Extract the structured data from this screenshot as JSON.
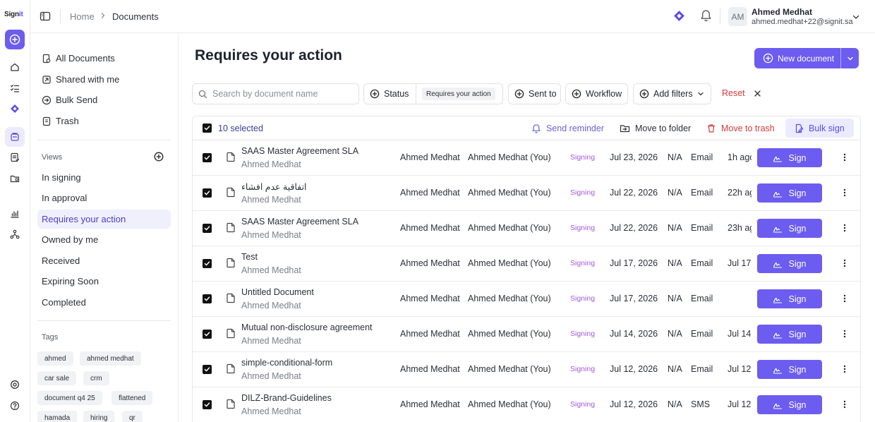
{
  "app": {
    "logo_main": "Sign",
    "logo_accent": "it"
  },
  "colors": {
    "accent": "#6d5cf0",
    "danger": "#d33a3a",
    "status_signing": "#a35bd6"
  },
  "rail": {
    "icons": [
      "new-document-icon",
      "home-icon",
      "tasks-icon",
      "workflow-diamond-icon",
      "documents-icon",
      "templates-icon",
      "folders-icon",
      "reports-icon",
      "integrations-icon",
      "settings-icon",
      "help-icon"
    ]
  },
  "topbar": {
    "breadcrumb": {
      "home": "Home",
      "current": "Documents"
    },
    "user": {
      "initials": "AM",
      "name": "Ahmed Medhat",
      "email": "ahmed.medhat+22@signit.sa"
    }
  },
  "sidebar": {
    "nav": [
      {
        "label": "All Documents",
        "icon": "all-documents-icon"
      },
      {
        "label": "Shared with me",
        "icon": "shared-icon"
      },
      {
        "label": "Bulk Send",
        "icon": "bulk-send-icon"
      },
      {
        "label": "Trash",
        "icon": "trash-icon"
      }
    ],
    "views_heading": "Views",
    "views": [
      "In signing",
      "In approval",
      "Requires your action",
      "Owned by me",
      "Received",
      "Expiring Soon",
      "Completed"
    ],
    "active_view": "Requires your action",
    "tags_heading": "Tags",
    "tags": [
      "ahmed",
      "ahmed medhat",
      "car sale",
      "crm",
      "document q4 25",
      "flattened",
      "hamada",
      "hiring",
      "qr"
    ]
  },
  "main": {
    "title": "Requires your action",
    "new_document": "New document",
    "search_placeholder": "Search by document name",
    "filters": {
      "status": "Status",
      "status_value": "Requires your action",
      "sent_to": "Sent to",
      "workflow": "Workflow",
      "add_filters": "Add filters",
      "reset": "Reset"
    }
  },
  "bulk": {
    "selected": "10 selected",
    "send_reminder": "Send reminder",
    "move_to_folder": "Move to folder",
    "move_to_trash": "Move to trash",
    "bulk_sign": "Bulk sign"
  },
  "rows": [
    {
      "title": "SAAS Master Agreement SLA",
      "owner": "Ahmed Medhat",
      "sender": "Ahmed Medhat",
      "recipient": "Ahmed Medhat (You)",
      "status": "Signing",
      "date": "Jul 23, 2026",
      "expiry": "N/A",
      "channel": "Email",
      "ago": "1h ago",
      "action": "Sign"
    },
    {
      "title": "اتفاقية عدم افشاء",
      "owner": "Ahmed Medhat",
      "sender": "Ahmed Medhat",
      "recipient": "Ahmed Medhat (You)",
      "status": "Signing",
      "date": "Jul 22, 2026",
      "expiry": "N/A",
      "channel": "Email",
      "ago": "22h ag",
      "action": "Sign"
    },
    {
      "title": "SAAS Master Agreement SLA",
      "owner": "Ahmed Medhat",
      "sender": "Ahmed Medhat",
      "recipient": "Ahmed Medhat (You)",
      "status": "Signing",
      "date": "Jul 22, 2026",
      "expiry": "N/A",
      "channel": "Email",
      "ago": "23h ag",
      "action": "Sign"
    },
    {
      "title": "Test",
      "owner": "Ahmed Medhat",
      "sender": "Ahmed Medhat",
      "recipient": "Ahmed Medhat (You)",
      "status": "Signing",
      "date": "Jul 17, 2026",
      "expiry": "N/A",
      "channel": "Email",
      "ago": "Jul 17",
      "action": "Sign"
    },
    {
      "title": "Untitled Document",
      "owner": "Ahmed Medhat",
      "sender": "Ahmed Medhat",
      "recipient": "Ahmed Medhat (You)",
      "status": "Signing",
      "date": "Jul 17, 2026",
      "expiry": "N/A",
      "channel": "Email",
      "ago": "",
      "action": "Sign"
    },
    {
      "title": "Mutual non-disclosure agreement",
      "owner": "Ahmed Medhat",
      "sender": "Ahmed Medhat",
      "recipient": "Ahmed Medhat (You)",
      "status": "Signing",
      "date": "Jul 14, 2026",
      "expiry": "N/A",
      "channel": "Email",
      "ago": "Jul 14",
      "action": "Sign"
    },
    {
      "title": "simple-conditional-form",
      "owner": "Ahmed Medhat",
      "sender": "Ahmed Medhat",
      "recipient": "Ahmed Medhat (You)",
      "status": "Signing",
      "date": "Jul 12, 2026",
      "expiry": "N/A",
      "channel": "Email",
      "ago": "Jul 12",
      "action": "Sign"
    },
    {
      "title": "DILZ-Brand-Guidelines",
      "owner": "Ahmed Medhat",
      "sender": "Ahmed Medhat",
      "recipient": "Ahmed Medhat (You)",
      "status": "Signing",
      "date": "Jul 12, 2026",
      "expiry": "N/A",
      "channel": "SMS",
      "ago": "Jul 12",
      "action": "Sign"
    }
  ]
}
